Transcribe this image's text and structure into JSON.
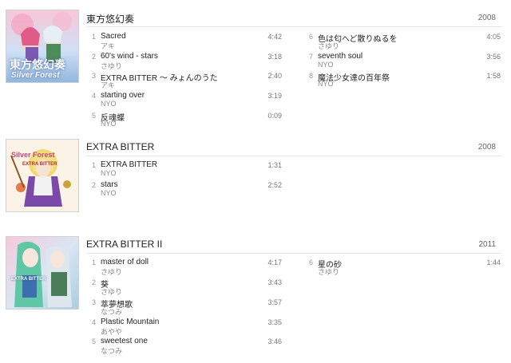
{
  "albums": [
    {
      "title": "東方悠幻奏",
      "year": "2008",
      "cover_text_top": "東方悠幻奏",
      "cover_text_bottom": "Silver Forest",
      "tracks_left": [
        {
          "num": "1",
          "name": "Sacred",
          "artist": "アキ",
          "duration": "4:42"
        },
        {
          "num": "2",
          "name": "60's wind - stars",
          "artist": "さゆり",
          "duration": "3:18"
        },
        {
          "num": "3",
          "name": "EXTRA BITTER 〜 みょんのうた",
          "artist": "アキ",
          "duration": "2:40"
        },
        {
          "num": "4",
          "name": "starting over",
          "artist": "NYO",
          "duration": "3:19"
        },
        {
          "num": "5",
          "name": "反魂蝶",
          "artist": "NYO",
          "duration": "0:09"
        }
      ],
      "tracks_right": [
        {
          "num": "6",
          "name": "色は匂へど散りぬるを",
          "artist": "さゆり",
          "duration": "4:05"
        },
        {
          "num": "7",
          "name": "seventh soul",
          "artist": "NYO",
          "duration": "3:56"
        },
        {
          "num": "8",
          "name": "魔法少女達の百年祭",
          "artist": "NYO",
          "duration": "1:58"
        }
      ]
    },
    {
      "title": "EXTRA BITTER",
      "year": "2008",
      "cover_text_top": "Silver Forest",
      "cover_text_bottom": "EXTRA BITTER",
      "tracks_left": [
        {
          "num": "1",
          "name": "EXTRA BITTER",
          "artist": "NYO",
          "duration": "1:31"
        },
        {
          "num": "2",
          "name": "stars",
          "artist": "NYO",
          "duration": "2:52"
        }
      ],
      "tracks_right": []
    },
    {
      "title": "EXTRA BITTER II",
      "year": "2011",
      "cover_text_top": "EXTRA BITTER",
      "cover_text_bottom": "",
      "tracks_left": [
        {
          "num": "1",
          "name": "master of doll",
          "artist": "さゆり",
          "duration": "4:17"
        },
        {
          "num": "2",
          "name": "葵",
          "artist": "さゆり",
          "duration": "3:43"
        },
        {
          "num": "3",
          "name": "萃夢想歌",
          "artist": "なつみ",
          "duration": "3:57"
        },
        {
          "num": "4",
          "name": "Plastic Mountain",
          "artist": "あやや",
          "duration": "3:35"
        },
        {
          "num": "5",
          "name": "sweetest one",
          "artist": "なつみ",
          "duration": "3:46"
        }
      ],
      "tracks_right": [
        {
          "num": "6",
          "name": "星の砂",
          "artist": "さゆり",
          "duration": "1:44"
        }
      ]
    }
  ]
}
